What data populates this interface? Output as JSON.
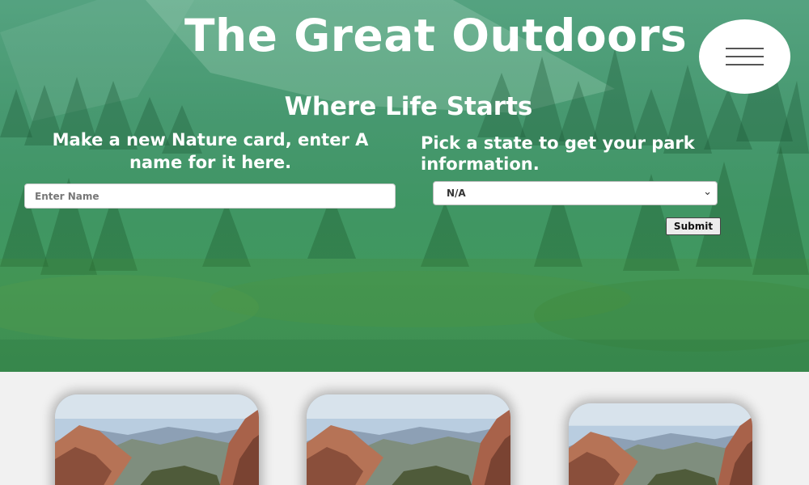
{
  "header": {
    "title": "The Great Outdoors",
    "menu_icon": "hamburger-menu-icon"
  },
  "hero": {
    "subtitle": "Where Life Starts"
  },
  "nature_card_form": {
    "label": "Make a new Nature card, enter A name for it here.",
    "name_input": {
      "value": "",
      "placeholder": "Enter Name"
    }
  },
  "park_form": {
    "label": "Pick a state to get your park information.",
    "state_select": {
      "selected": "N/A",
      "icon": "chevron-down-icon"
    },
    "submit_label": "Submit"
  },
  "cards": [
    {
      "image": "canyon-landscape-photo"
    },
    {
      "image": "canyon-landscape-photo"
    },
    {
      "image": "canyon-landscape-photo"
    }
  ],
  "colors": {
    "hero_overlay": "#4aaa80",
    "white": "#ffffff",
    "page_background": "#f1f1f1",
    "menu_bars": "#555555"
  }
}
